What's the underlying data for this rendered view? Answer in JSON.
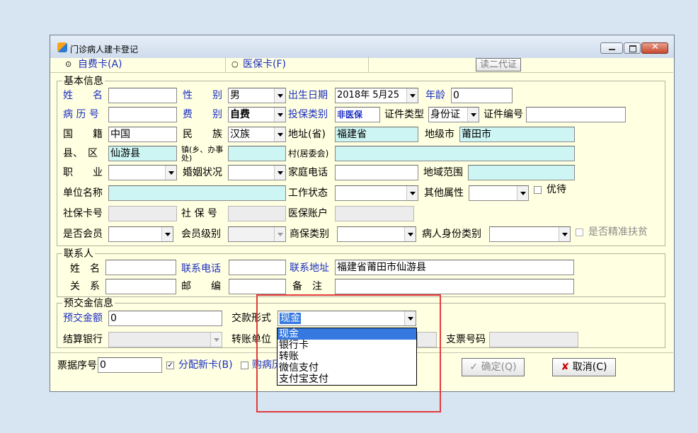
{
  "window": {
    "title": "门诊病人建卡登记"
  },
  "card_type": {
    "self_pay": "自费卡(A)",
    "insurance": "医保卡(F)",
    "read_id_button": "读二代证"
  },
  "basic": {
    "group_title": "基本信息",
    "name_label": "姓　　名",
    "name_value": "",
    "gender_label": "性　　别",
    "gender_value": "男",
    "birth_label": "出生日期",
    "birth_value": "2018年 5月25",
    "age_label": "年龄",
    "age_value": "0",
    "record_label": "病 历 号",
    "record_value": "",
    "fee_label": "费　　别",
    "fee_value": "自费",
    "ins_type_label": "投保类别",
    "ins_type_value": "非医保",
    "id_type_label": "证件类型",
    "id_type_value": "身份证",
    "id_no_label": "证件编号",
    "id_no_value": "",
    "nationality_label": "国　　籍",
    "nationality_value": "中国",
    "ethnic_label": "民　　族",
    "ethnic_value": "汉族",
    "province_label": "地址(省)",
    "province_value": "福建省",
    "city_label": "地级市",
    "city_value": "莆田市",
    "county_label": "县、　区",
    "county_value": "仙游县",
    "town_label": "镇(乡、办事处)",
    "town_value": "",
    "village_label": "村(居委会)",
    "village_value": "",
    "job_label": "职　　业",
    "job_value": "",
    "marital_label": "婚姻状况",
    "marital_value": "",
    "home_phone_label": "家庭电话",
    "home_phone_value": "",
    "region_label": "地域范围",
    "region_value": "",
    "employer_label": "单位名称",
    "employer_value": "",
    "work_status_label": "工作状态",
    "work_status_value": "",
    "other_attr_label": "其他属性",
    "other_attr_value": "",
    "vip_label": "优待",
    "social_card_label": "社保卡号",
    "social_card_value": "",
    "social_no_label": "社 保 号",
    "social_no_value": "",
    "medical_account_label": "医保账户",
    "medical_account_value": "",
    "member_label": "是否会员",
    "member_value": "",
    "member_level_label": "会员级别",
    "member_level_value": "",
    "commercial_label": "商保类别",
    "commercial_value": "",
    "patient_identity_label": "病人身份类别",
    "patient_identity_value": "",
    "poverty_label": "是否精准扶贫"
  },
  "contact": {
    "group_title": "联系人",
    "name_label": "姓　名",
    "name_value": "",
    "phone_label": "联系电话",
    "phone_value": "",
    "address_label": "联系地址",
    "address_value": "福建省莆田市仙游县",
    "relation_label": "关　系",
    "relation_value": "",
    "postcode_label": "邮　　编",
    "postcode_value": "",
    "remark_label": "备　注",
    "remark_value": ""
  },
  "deposit": {
    "group_title": "预交金信息",
    "amount_label": "预交金额",
    "amount_value": "0",
    "payment_label": "交款形式",
    "payment_value": "现金",
    "payment_options": [
      "现金",
      "银行卡",
      "转账",
      "微信支付",
      "支付宝支付"
    ],
    "bank_label": "结算银行",
    "bank_value": "",
    "transfer_label": "转账单位",
    "check_label": "支票号码",
    "check_value": ""
  },
  "footer": {
    "receipt_label": "票据序号",
    "receipt_value": "0",
    "new_card_label": "分配新卡(B)",
    "buy_record_label": "购病历",
    "ok_label": "确定(Q)",
    "cancel_label": "取消(C)"
  }
}
